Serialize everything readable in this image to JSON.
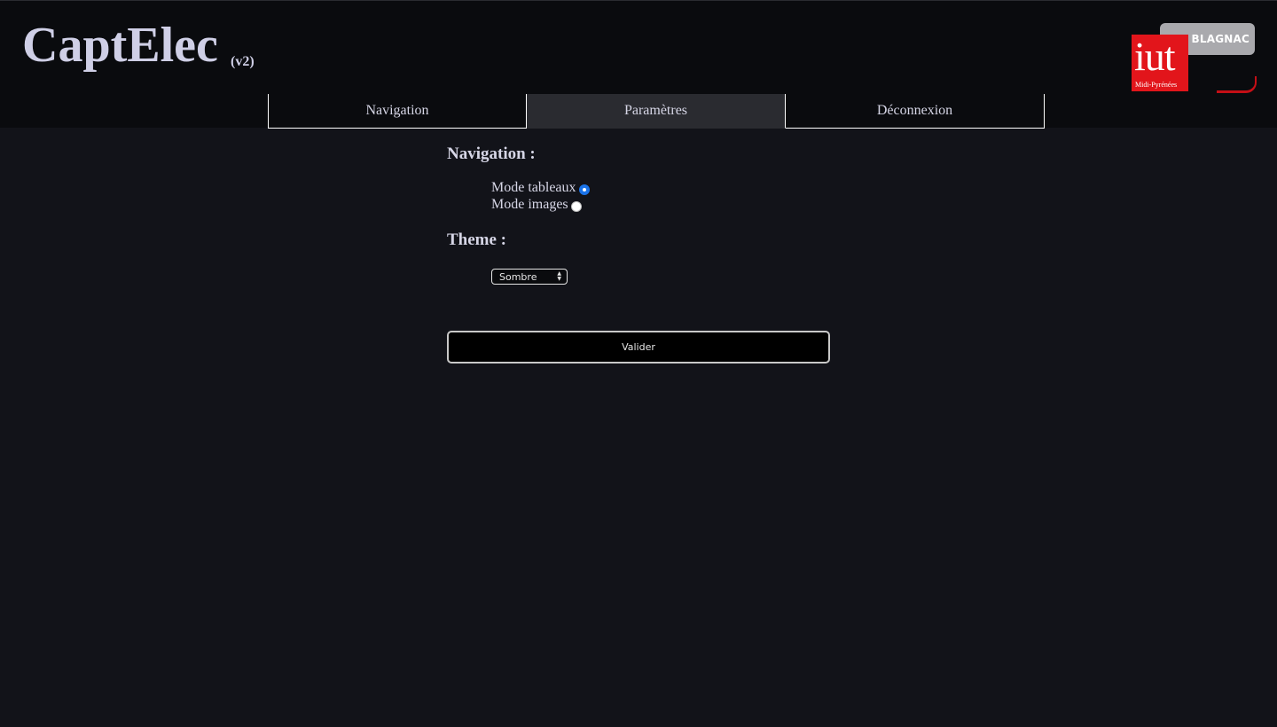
{
  "app": {
    "title": "CaptElec",
    "version": "(v2)"
  },
  "logo": {
    "blagnac": "BLAGNAC",
    "iut": "iut",
    "sub": "Midi-Pyrénées"
  },
  "tabs": [
    {
      "label": "Navigation",
      "active": false
    },
    {
      "label": "Paramètres",
      "active": true
    },
    {
      "label": "Déconnexion",
      "active": false
    }
  ],
  "settings": {
    "navigation": {
      "title": "Navigation :",
      "options": [
        {
          "label": "Mode tableaux",
          "checked": true
        },
        {
          "label": "Mode images",
          "checked": false
        }
      ]
    },
    "theme": {
      "title": "Theme :",
      "selected": "Sombre"
    },
    "submit_label": "Valider"
  },
  "colors": {
    "background": "#121319",
    "header": "#0a0b0e",
    "active_tab": "#2a2b30",
    "radio_checked": "#1a73e8",
    "logo_red": "#e2151b"
  }
}
